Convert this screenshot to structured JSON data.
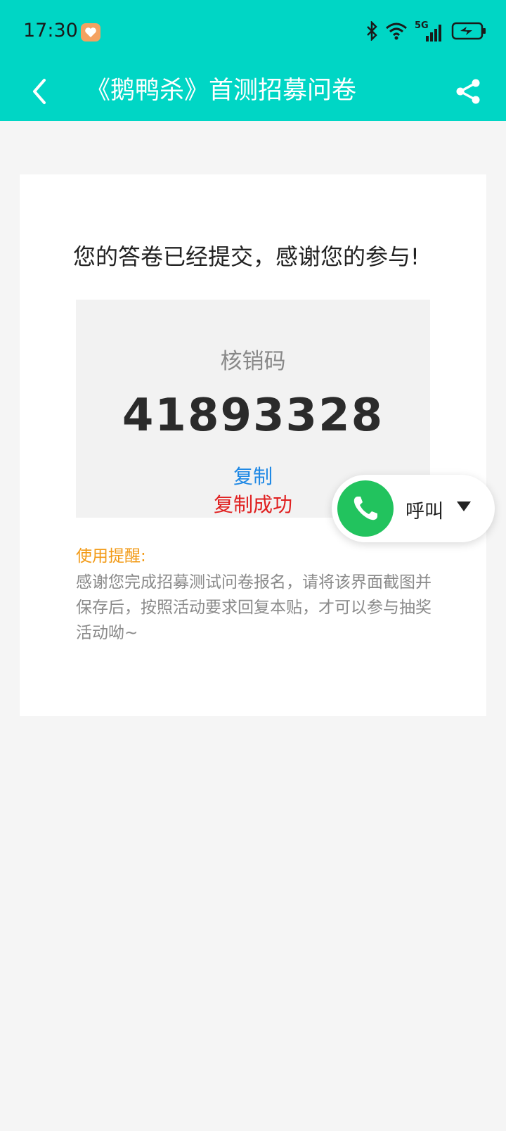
{
  "status_bar": {
    "time": "17:30",
    "network": "5G",
    "icons": [
      "bluetooth-icon",
      "wifi-icon",
      "signal-icon",
      "battery-charging-icon"
    ]
  },
  "nav": {
    "title": "《鹅鸭杀》首测招募问卷",
    "back_icon": "chevron-left-icon",
    "share_icon": "share-icon"
  },
  "card": {
    "thanks_text": "您的答卷已经提交，感谢您的参与!",
    "code_label": "核销码",
    "code_value": "41893328",
    "copy_label": "复制",
    "copy_success": "复制成功",
    "reminder_title": "使用提醒:",
    "reminder_body": "感谢您完成招募测试问卷报名，请将该界面截图并保存后，按照活动要求回复本贴，才可以参与抽奖活动呦~"
  },
  "call_widget": {
    "label": "呼叫",
    "icon": "phone-icon"
  },
  "colors": {
    "header": "#00d6c5",
    "link": "#1e88e5",
    "success": "#e01f1f",
    "reminder": "#f29a16",
    "call": "#22c35e"
  }
}
